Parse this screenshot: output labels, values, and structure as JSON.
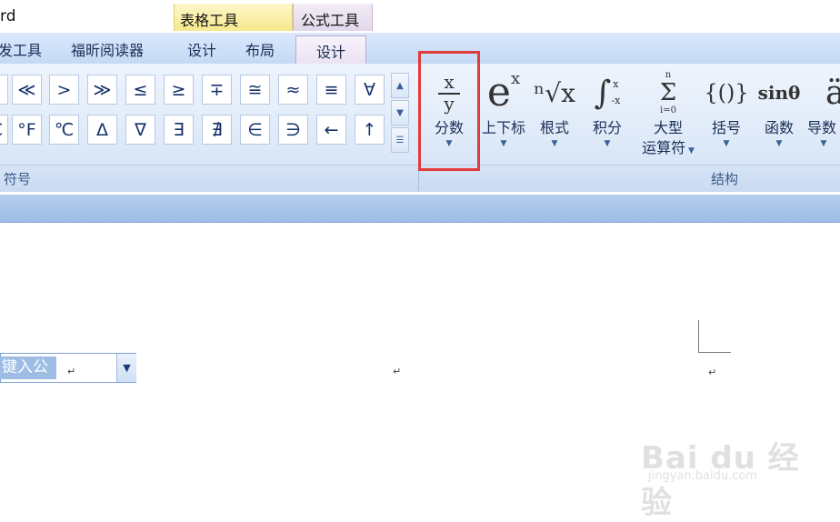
{
  "window": {
    "app_title": "rd"
  },
  "context_tabs": {
    "table_tools": "表格工具",
    "formula_tools": "公式工具"
  },
  "tabs": [
    {
      "label": "发工具"
    },
    {
      "label": "福昕阅读器"
    },
    {
      "label": "设计"
    },
    {
      "label": "布局"
    },
    {
      "label": "设计"
    }
  ],
  "symbols": {
    "row1": [
      "«",
      "<",
      "≪",
      ">",
      "≫",
      "≤",
      "≥",
      "∓",
      "≅",
      "≈",
      "≡",
      "∀"
    ],
    "row2": [
      "℃",
      "°F",
      "℃",
      "Δ",
      "∇",
      "∃",
      "∄",
      "∈",
      "∋",
      "←",
      "↑"
    ]
  },
  "groups": {
    "symbols_label": "符号",
    "structure_label": "结构"
  },
  "structures": [
    {
      "label": "分数",
      "icon": "fraction-icon",
      "glyph_top": "x",
      "glyph_bottom": "y"
    },
    {
      "label": "上下标",
      "icon": "script-icon",
      "glyph": "e",
      "glyph_sup": "x"
    },
    {
      "label": "根式",
      "icon": "radical-icon",
      "glyph": "ⁿ√x"
    },
    {
      "label": "积分",
      "icon": "integral-icon",
      "glyph": "∫",
      "glyph_sup": "x",
      "glyph_sub": "-x"
    },
    {
      "label": "大型",
      "label2": "运算符",
      "icon": "large-operator-icon",
      "glyph": "Σ",
      "glyph_sup": "n",
      "glyph_sub": "i=0"
    },
    {
      "label": "括号",
      "icon": "bracket-icon",
      "glyph": "{()}"
    },
    {
      "label": "函数",
      "icon": "function-icon",
      "glyph": "sinθ"
    },
    {
      "label": "导数",
      "icon": "accent-icon",
      "glyph": "ä"
    }
  ],
  "document": {
    "formula_placeholder": "键入公",
    "para_mark": "↵"
  },
  "watermark": {
    "brand": "Bai du 经验",
    "url": "jingyan.baidu.com"
  },
  "colors": {
    "highlight": "#e23b3b",
    "ribbon": "#dce8f8",
    "tab_row": "#c4d9f6"
  }
}
